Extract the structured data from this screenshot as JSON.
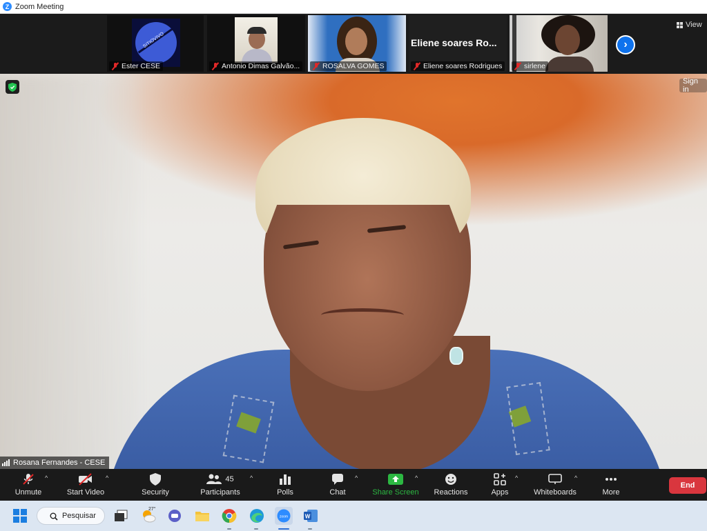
{
  "window": {
    "title": "Zoom Meeting"
  },
  "gallery": {
    "tiles": [
      {
        "name": "Ester CESE",
        "muted": true,
        "logo_text": "SITIOVIVO"
      },
      {
        "name": "Antonio Dimas Galvão...",
        "muted": true
      },
      {
        "name": "ROSALVA GOMES",
        "muted": true
      },
      {
        "name": "Eliene soares Rodrigues",
        "muted": true,
        "big_label": "Eliene soares Ro..."
      },
      {
        "name": "sirlene",
        "muted": true
      }
    ],
    "view_label": "View"
  },
  "main_video": {
    "speaker_name": "Rosana Fernandes - CESE",
    "sign_in_label": "Sign in"
  },
  "toolbar": {
    "unmute": "Unmute",
    "start_video": "Start Video",
    "security": "Security",
    "participants": "Participants",
    "participants_count": "45",
    "polls": "Polls",
    "chat": "Chat",
    "share_screen": "Share Screen",
    "reactions": "Reactions",
    "apps": "Apps",
    "whiteboards": "Whiteboards",
    "more": "More",
    "end": "End"
  },
  "taskbar": {
    "search_label": "Pesquisar",
    "weather_temp": "27°"
  },
  "colors": {
    "zoom_blue": "#2d8cff",
    "end_red": "#d9363e",
    "share_green": "#2cb742",
    "muted_red": "#e02828"
  }
}
